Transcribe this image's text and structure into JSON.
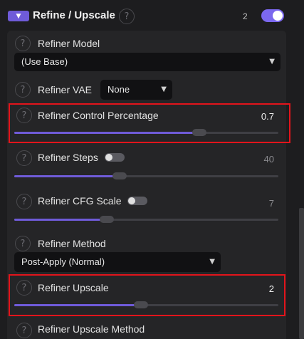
{
  "header": {
    "title": "Refine / Upscale",
    "help_glyph": "?",
    "count": "2",
    "enabled": true
  },
  "fields": {
    "refiner_model": {
      "label": "Refiner Model",
      "value": "(Use Base)"
    },
    "refiner_vae": {
      "label": "Refiner VAE",
      "value": "None"
    },
    "control_percentage": {
      "label": "Refiner Control Percentage",
      "value": "0.7",
      "fraction": 0.7
    },
    "steps": {
      "label": "Refiner Steps",
      "value": "40",
      "fraction": 0.4,
      "toggle_on": false
    },
    "cfg_scale": {
      "label": "Refiner CFG Scale",
      "value": "7",
      "fraction": 0.35,
      "toggle_on": false
    },
    "method": {
      "label": "Refiner Method",
      "value": "Post-Apply (Normal)"
    },
    "upscale": {
      "label": "Refiner Upscale",
      "value": "2",
      "fraction": 0.48
    },
    "upscale_method": {
      "label": "Refiner Upscale Method"
    }
  },
  "colors": {
    "accent": "#6f5bd9",
    "highlight": "#e3141b",
    "panel": "#252527"
  },
  "icons": {
    "help": "question-circle-icon",
    "caret": "chevron-down-icon"
  }
}
